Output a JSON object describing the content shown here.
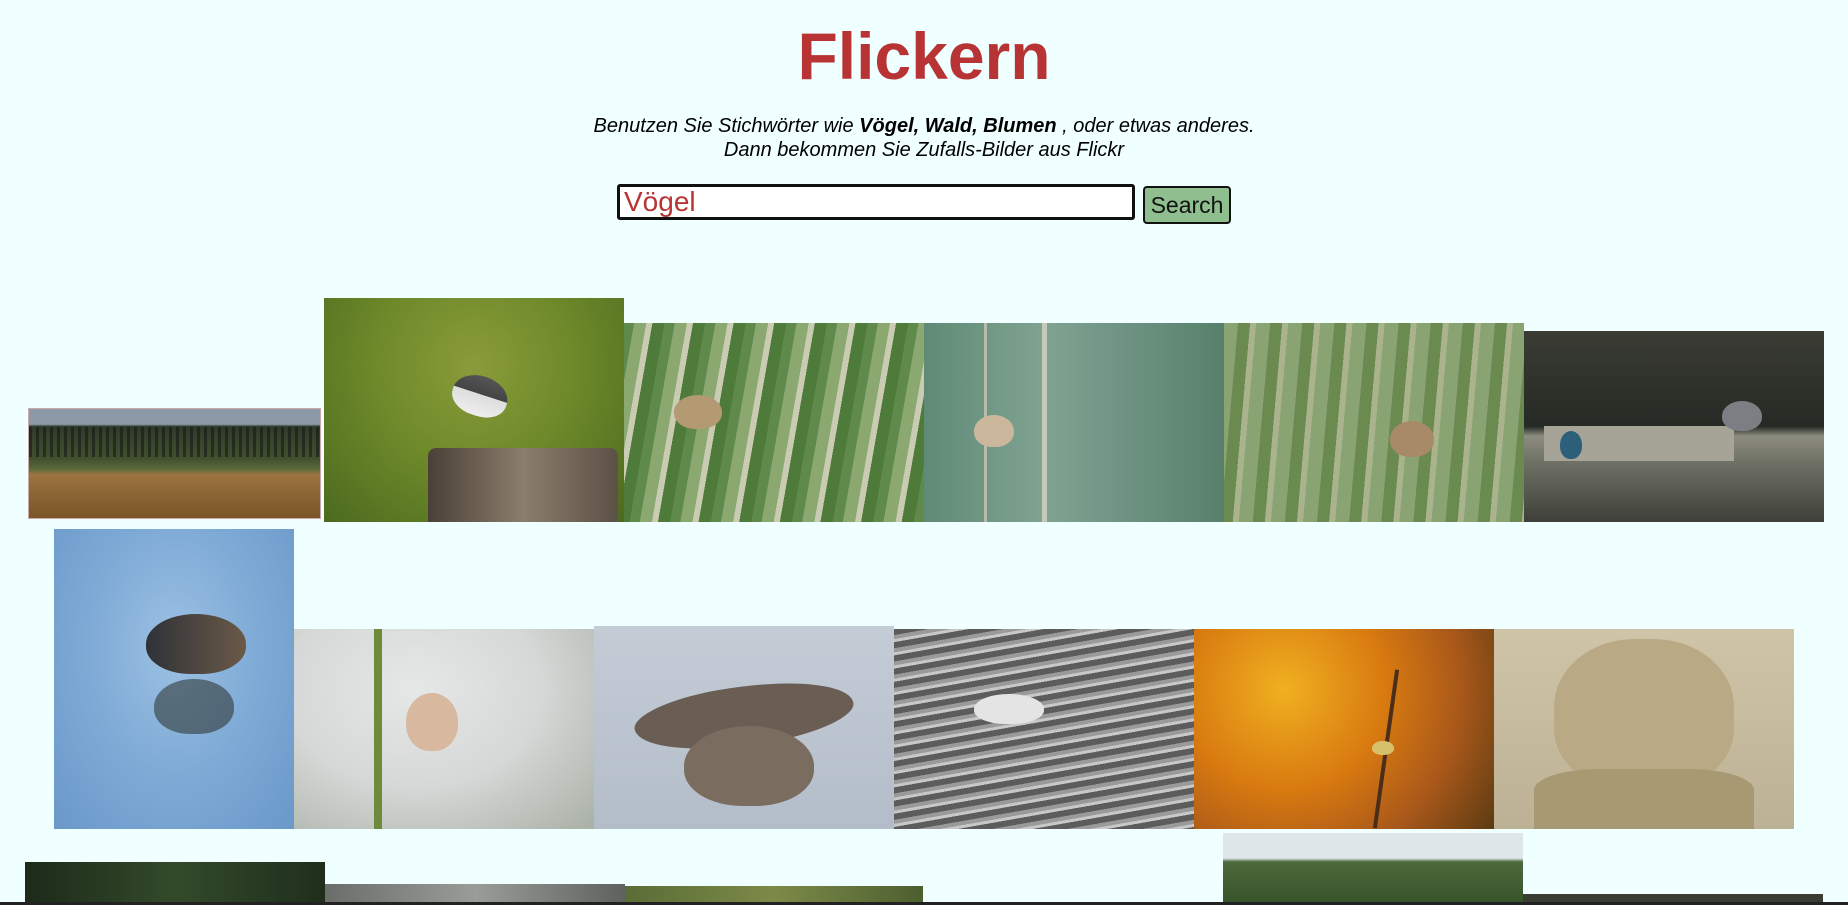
{
  "app": {
    "title": "Flickern"
  },
  "intro": {
    "line1_prefix": "Benutzen Sie Stichwörter wie ",
    "line1_keywords": "Vögel, Wald, Blumen",
    "line1_suffix": " , oder etwas anderes.",
    "line2": "Dann bekommen Sie Zufalls-Bilder aus Flickr"
  },
  "search": {
    "value": "Vögel",
    "button_label": "Search"
  },
  "colors": {
    "title": "#b83434",
    "background": "#f0ffff",
    "button": "#8fbf8f"
  },
  "gallery": {
    "photos": [
      {
        "name": "bird-flock-over-field",
        "subject": "starling-flock-icon"
      },
      {
        "name": "wagtail-on-stump",
        "subject": "bird-icon"
      },
      {
        "name": "warbler-in-reeds-1",
        "subject": "bird-icon"
      },
      {
        "name": "warbler-on-stalk",
        "subject": "bird-icon"
      },
      {
        "name": "warbler-in-reeds-2",
        "subject": "bird-icon"
      },
      {
        "name": "heron-and-kingfisher",
        "subject": "heron-icon"
      },
      {
        "name": "moorhen-on-water",
        "subject": "moorhen-icon"
      },
      {
        "name": "bearded-reedling",
        "subject": "bird-icon"
      },
      {
        "name": "buzzard-in-flight",
        "subject": "raptor-icon"
      },
      {
        "name": "sandpiper-in-water",
        "subject": "wader-icon"
      },
      {
        "name": "bird-in-autumn-branches",
        "subject": "bird-icon"
      },
      {
        "name": "yoda-sand-sculpture",
        "subject": "statue-icon"
      },
      {
        "name": "dark-foliage-photo",
        "subject": "photo-icon"
      },
      {
        "name": "grey-photo",
        "subject": "photo-icon"
      },
      {
        "name": "grass-photo",
        "subject": "photo-icon"
      },
      {
        "name": "trees-photo",
        "subject": "photo-icon"
      },
      {
        "name": "dark-edge-photo",
        "subject": "photo-icon"
      }
    ]
  }
}
